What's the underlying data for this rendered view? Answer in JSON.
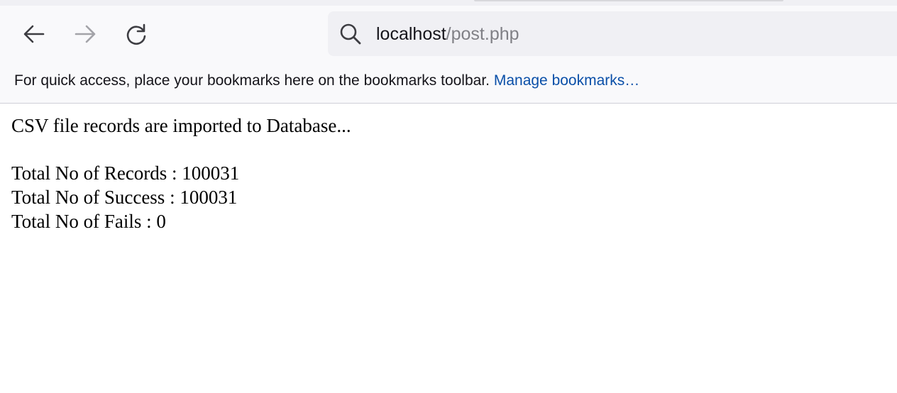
{
  "browser": {
    "url_host": "localhost",
    "url_path": "/post.php",
    "bookmarks_text": "For quick access, place your bookmarks here on the bookmarks toolbar.",
    "manage_bookmarks_label": "Manage bookmarks…",
    "icons": {
      "back": "arrow-left-icon",
      "forward": "arrow-right-icon",
      "reload": "reload-icon",
      "search": "search-icon"
    }
  },
  "page": {
    "message": "CSV file records are imported to Database...",
    "total_records": "Total No of Records : 100031",
    "total_success": "Total No of Success : 100031",
    "total_fails": "Total No of Fails : 0"
  }
}
